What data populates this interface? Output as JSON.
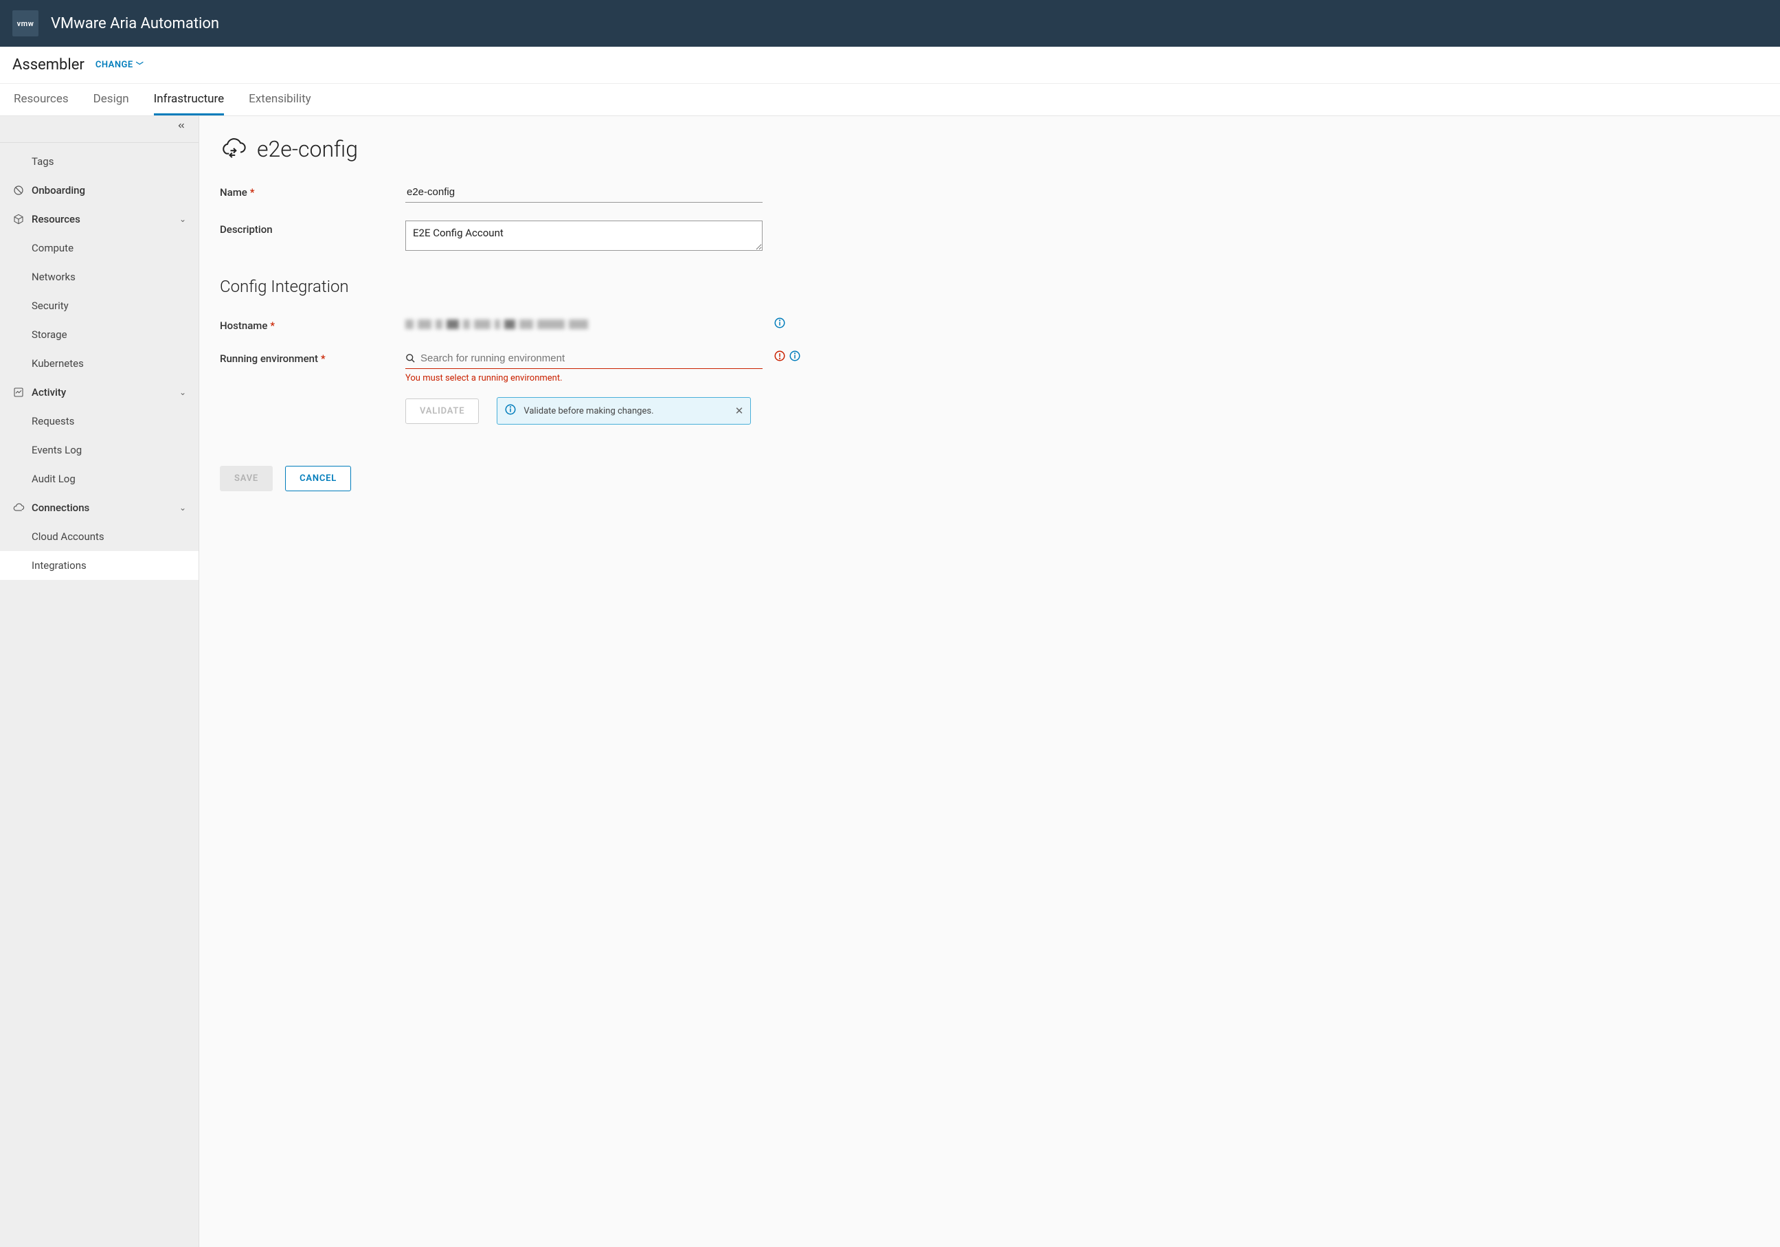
{
  "header": {
    "logo_text": "vmw",
    "product_name": "VMware Aria Automation"
  },
  "subheader": {
    "module": "Assembler",
    "change_label": "CHANGE"
  },
  "tabs": [
    {
      "label": "Resources",
      "active": false
    },
    {
      "label": "Design",
      "active": false
    },
    {
      "label": "Infrastructure",
      "active": true
    },
    {
      "label": "Extensibility",
      "active": false
    }
  ],
  "sidebar": {
    "items": [
      {
        "type": "item",
        "label": "Tags",
        "indent": true
      },
      {
        "type": "group",
        "label": "Onboarding",
        "icon": "onboarding",
        "expandable": false
      },
      {
        "type": "group",
        "label": "Resources",
        "icon": "cube",
        "expandable": true
      },
      {
        "type": "item",
        "label": "Compute",
        "indent": true
      },
      {
        "type": "item",
        "label": "Networks",
        "indent": true
      },
      {
        "type": "item",
        "label": "Security",
        "indent": true
      },
      {
        "type": "item",
        "label": "Storage",
        "indent": true
      },
      {
        "type": "item",
        "label": "Kubernetes",
        "indent": true
      },
      {
        "type": "group",
        "label": "Activity",
        "icon": "chart",
        "expandable": true
      },
      {
        "type": "item",
        "label": "Requests",
        "indent": true
      },
      {
        "type": "item",
        "label": "Events Log",
        "indent": true
      },
      {
        "type": "item",
        "label": "Audit Log",
        "indent": true
      },
      {
        "type": "group",
        "label": "Connections",
        "icon": "cloud",
        "expandable": true
      },
      {
        "type": "item",
        "label": "Cloud Accounts",
        "indent": true
      },
      {
        "type": "item",
        "label": "Integrations",
        "indent": true,
        "active": true
      }
    ]
  },
  "main": {
    "page_title": "e2e-config",
    "fields": {
      "name": {
        "label": "Name",
        "value": "e2e-config",
        "required": true
      },
      "description": {
        "label": "Description",
        "value": "E2E Config Account",
        "required": false
      },
      "section_heading": "Config Integration",
      "hostname": {
        "label": "Hostname",
        "required": true
      },
      "running_env": {
        "label": "Running environment",
        "required": true,
        "placeholder": "Search for running environment",
        "value": "",
        "error": "You must select a running environment."
      }
    },
    "buttons": {
      "validate": "VALIDATE",
      "save": "SAVE",
      "cancel": "CANCEL"
    },
    "alert": {
      "text": "Validate before making changes."
    }
  }
}
